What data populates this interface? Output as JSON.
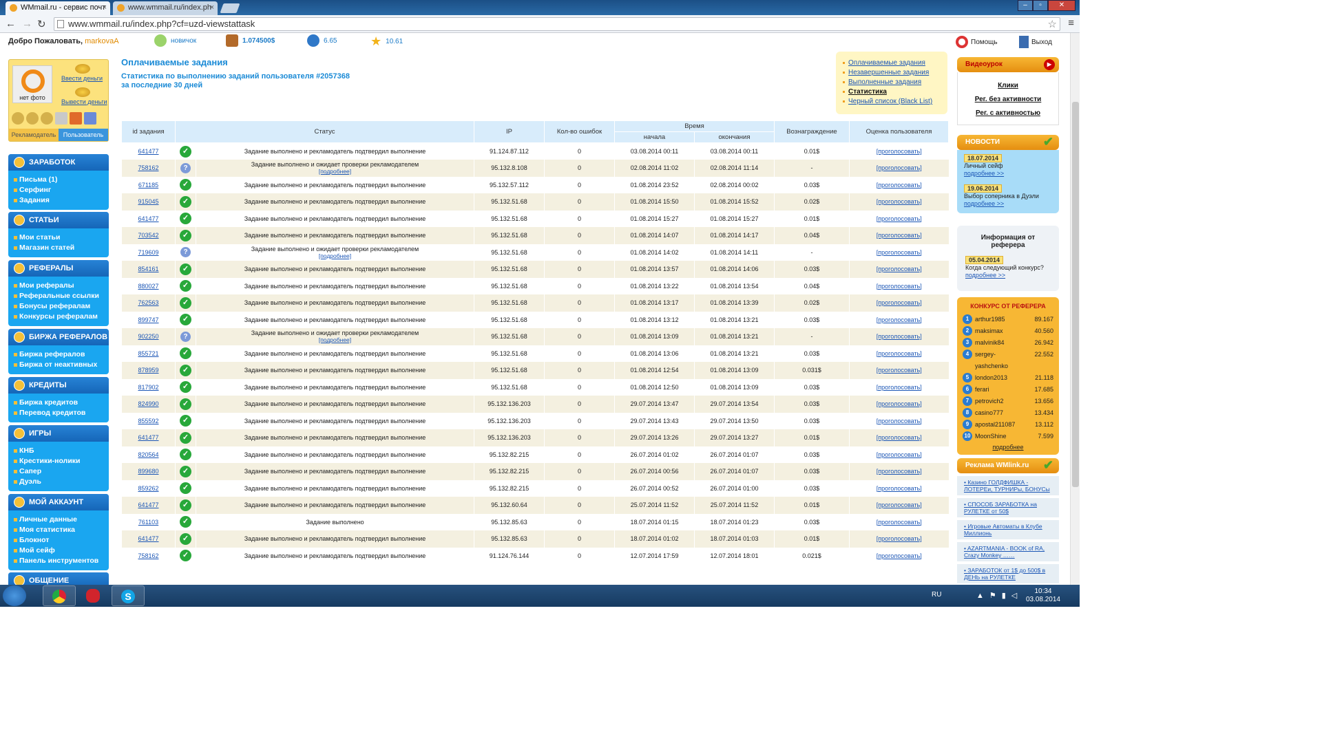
{
  "browser": {
    "tabs": [
      {
        "title": "WMmail.ru - сервис почт",
        "active": true
      },
      {
        "title": "www.wmmail.ru/index.ph",
        "active": false
      }
    ],
    "url": "www.wmmail.ru/index.php?cf=uzd-viewstattask"
  },
  "header": {
    "welcome": "Добро Пожаловать,",
    "username": "markovaA",
    "level": "новичок",
    "balance": "1.074500$",
    "credits": "6.65",
    "rating": "10.61",
    "help": "Помощь",
    "exit": "Выход"
  },
  "profile": {
    "no_photo": "нет фото",
    "deposit": "Ввести деньги",
    "withdraw": "Вывести деньги",
    "role_advertiser": "Рекламодатель",
    "role_user": "Пользователь"
  },
  "sidebar": [
    {
      "title": "ЗАРАБОТОК",
      "items": [
        "Письма (1)",
        "Серфинг",
        "Задания"
      ]
    },
    {
      "title": "СТАТЬИ",
      "items": [
        "Мои статьи",
        "Магазин статей"
      ]
    },
    {
      "title": "РЕФЕРАЛЫ",
      "items": [
        "Мои рефералы",
        "Реферальные ссылки",
        "Бонусы рефералам",
        "Конкурсы рефералам"
      ]
    },
    {
      "title": "БИРЖА РЕФЕРАЛОВ",
      "items": [
        "Биржа рефералов",
        "Биржа от неактивных"
      ]
    },
    {
      "title": "КРЕДИТЫ",
      "items": [
        "Биржа кредитов",
        "Перевод кредитов"
      ]
    },
    {
      "title": "ИГРЫ",
      "items": [
        "КНБ",
        "Крестики-нолики",
        "Сапер",
        "Дуэль"
      ]
    },
    {
      "title": "МОЙ АККАУНТ",
      "items": [
        "Личные данные",
        "Моя статистика",
        "Блокнот",
        "Мой сейф",
        "Панель инструментов"
      ]
    },
    {
      "title": "ОБЩЕНИЕ",
      "items": []
    }
  ],
  "main": {
    "title": "Оплачиваемые задания",
    "subtitle_1": "Статистика по выполнению заданий пользователя #2057368",
    "subtitle_2": "за последние 30 дней"
  },
  "task_menu": [
    "Оплачиваемые задания",
    "Незавершенные задания",
    "Выполненные задания",
    "Статистика",
    "Черный список (Black List)"
  ],
  "table": {
    "headers": {
      "id": "id задания",
      "status": "Статус",
      "ip": "IP",
      "errors": "Кол-во ошибок",
      "time": "Время",
      "start": "начала",
      "end": "окончания",
      "reward": "Вознаграждение",
      "rating": "Оценка пользователя"
    },
    "vote_label": "[проголосовать]",
    "more_label": "[подробнее]",
    "rows": [
      {
        "id": "641477",
        "state": "ok",
        "status": "Задание выполнено и рекламодатель подтвердил выполнение",
        "ip": "91.124.87.112",
        "errors": "0",
        "start": "03.08.2014 00:11",
        "end": "03.08.2014 00:11",
        "reward": "0.01$"
      },
      {
        "id": "758162",
        "state": "pending",
        "status": "Задание выполнено и ожидает проверки рекламодателем",
        "ip": "95.132.8.108",
        "errors": "0",
        "start": "02.08.2014 11:02",
        "end": "02.08.2014 11:14",
        "reward": "-"
      },
      {
        "id": "671185",
        "state": "ok",
        "status": "Задание выполнено и рекламодатель подтвердил выполнение",
        "ip": "95.132.57.112",
        "errors": "0",
        "start": "01.08.2014 23:52",
        "end": "02.08.2014 00:02",
        "reward": "0.03$"
      },
      {
        "id": "915045",
        "state": "ok",
        "status": "Задание выполнено и рекламодатель подтвердил выполнение",
        "ip": "95.132.51.68",
        "errors": "0",
        "start": "01.08.2014 15:50",
        "end": "01.08.2014 15:52",
        "reward": "0.02$"
      },
      {
        "id": "641477",
        "state": "ok",
        "status": "Задание выполнено и рекламодатель подтвердил выполнение",
        "ip": "95.132.51.68",
        "errors": "0",
        "start": "01.08.2014 15:27",
        "end": "01.08.2014 15:27",
        "reward": "0.01$"
      },
      {
        "id": "703542",
        "state": "ok",
        "status": "Задание выполнено и рекламодатель подтвердил выполнение",
        "ip": "95.132.51.68",
        "errors": "0",
        "start": "01.08.2014 14:07",
        "end": "01.08.2014 14:17",
        "reward": "0.04$"
      },
      {
        "id": "719609",
        "state": "pending",
        "status": "Задание выполнено и ожидает проверки рекламодателем",
        "ip": "95.132.51.68",
        "errors": "0",
        "start": "01.08.2014 14:02",
        "end": "01.08.2014 14:11",
        "reward": "-"
      },
      {
        "id": "854161",
        "state": "ok",
        "status": "Задание выполнено и рекламодатель подтвердил выполнение",
        "ip": "95.132.51.68",
        "errors": "0",
        "start": "01.08.2014 13:57",
        "end": "01.08.2014 14:06",
        "reward": "0.03$"
      },
      {
        "id": "880027",
        "state": "ok",
        "status": "Задание выполнено и рекламодатель подтвердил выполнение",
        "ip": "95.132.51.68",
        "errors": "0",
        "start": "01.08.2014 13:22",
        "end": "01.08.2014 13:54",
        "reward": "0.04$"
      },
      {
        "id": "762563",
        "state": "ok",
        "status": "Задание выполнено и рекламодатель подтвердил выполнение",
        "ip": "95.132.51.68",
        "errors": "0",
        "start": "01.08.2014 13:17",
        "end": "01.08.2014 13:39",
        "reward": "0.02$"
      },
      {
        "id": "899747",
        "state": "ok",
        "status": "Задание выполнено и рекламодатель подтвердил выполнение",
        "ip": "95.132.51.68",
        "errors": "0",
        "start": "01.08.2014 13:12",
        "end": "01.08.2014 13:21",
        "reward": "0.03$"
      },
      {
        "id": "902250",
        "state": "pending",
        "status": "Задание выполнено и ожидает проверки рекламодателем",
        "ip": "95.132.51.68",
        "errors": "0",
        "start": "01.08.2014 13:09",
        "end": "01.08.2014 13:21",
        "reward": "-"
      },
      {
        "id": "855721",
        "state": "ok",
        "status": "Задание выполнено и рекламодатель подтвердил выполнение",
        "ip": "95.132.51.68",
        "errors": "0",
        "start": "01.08.2014 13:06",
        "end": "01.08.2014 13:21",
        "reward": "0.03$"
      },
      {
        "id": "878959",
        "state": "ok",
        "status": "Задание выполнено и рекламодатель подтвердил выполнение",
        "ip": "95.132.51.68",
        "errors": "0",
        "start": "01.08.2014 12:54",
        "end": "01.08.2014 13:09",
        "reward": "0.031$"
      },
      {
        "id": "817902",
        "state": "ok",
        "status": "Задание выполнено и рекламодатель подтвердил выполнение",
        "ip": "95.132.51.68",
        "errors": "0",
        "start": "01.08.2014 12:50",
        "end": "01.08.2014 13:09",
        "reward": "0.03$"
      },
      {
        "id": "824990",
        "state": "ok",
        "status": "Задание выполнено и рекламодатель подтвердил выполнение",
        "ip": "95.132.136.203",
        "errors": "0",
        "start": "29.07.2014 13:47",
        "end": "29.07.2014 13:54",
        "reward": "0.03$"
      },
      {
        "id": "855592",
        "state": "ok",
        "status": "Задание выполнено и рекламодатель подтвердил выполнение",
        "ip": "95.132.136.203",
        "errors": "0",
        "start": "29.07.2014 13:43",
        "end": "29.07.2014 13:50",
        "reward": "0.03$"
      },
      {
        "id": "641477",
        "state": "ok",
        "status": "Задание выполнено и рекламодатель подтвердил выполнение",
        "ip": "95.132.136.203",
        "errors": "0",
        "start": "29.07.2014 13:26",
        "end": "29.07.2014 13:27",
        "reward": "0.01$"
      },
      {
        "id": "820564",
        "state": "ok",
        "status": "Задание выполнено и рекламодатель подтвердил выполнение",
        "ip": "95.132.82.215",
        "errors": "0",
        "start": "26.07.2014 01:02",
        "end": "26.07.2014 01:07",
        "reward": "0.03$"
      },
      {
        "id": "899680",
        "state": "ok",
        "status": "Задание выполнено и рекламодатель подтвердил выполнение",
        "ip": "95.132.82.215",
        "errors": "0",
        "start": "26.07.2014 00:56",
        "end": "26.07.2014 01:07",
        "reward": "0.03$"
      },
      {
        "id": "859262",
        "state": "ok",
        "status": "Задание выполнено и рекламодатель подтвердил выполнение",
        "ip": "95.132.82.215",
        "errors": "0",
        "start": "26.07.2014 00:52",
        "end": "26.07.2014 01:00",
        "reward": "0.03$"
      },
      {
        "id": "641477",
        "state": "ok",
        "status": "Задание выполнено и рекламодатель подтвердил выполнение",
        "ip": "95.132.60.64",
        "errors": "0",
        "start": "25.07.2014 11:52",
        "end": "25.07.2014 11:52",
        "reward": "0.01$"
      },
      {
        "id": "761103",
        "state": "ok",
        "status": "Задание выполнено",
        "ip": "95.132.85.63",
        "errors": "0",
        "start": "18.07.2014 01:15",
        "end": "18.07.2014 01:23",
        "reward": "0.03$"
      },
      {
        "id": "641477",
        "state": "ok",
        "status": "Задание выполнено и рекламодатель подтвердил выполнение",
        "ip": "95.132.85.63",
        "errors": "0",
        "start": "18.07.2014 01:02",
        "end": "18.07.2014 01:03",
        "reward": "0.01$"
      },
      {
        "id": "758162",
        "state": "ok",
        "status": "Задание выполнено и рекламодатель подтвердил выполнение",
        "ip": "91.124.76.144",
        "errors": "0",
        "start": "12.07.2014 17:59",
        "end": "12.07.2014 18:01",
        "reward": "0.021$"
      }
    ]
  },
  "right": {
    "video": {
      "title": "Видеоурок",
      "links": [
        "Клики",
        "Рег. без активности",
        "Рег. с активностью"
      ]
    },
    "news": {
      "title": "НОВОСТИ",
      "items": [
        {
          "date": "18.07.2014",
          "text": "Личный сейф"
        },
        {
          "date": "19.06.2014",
          "text": "Выбор соперника в Дуэли"
        }
      ],
      "more": "подробнее >>"
    },
    "referrer": {
      "title": "Информация от реферера",
      "date": "05.04.2014",
      "text": "Когда следующий конкурс?",
      "more": "подробнее >>"
    },
    "contest": {
      "title": "КОНКУРС ОТ РЕФЕРЕРА",
      "rows": [
        {
          "n": "1",
          "name": "arthur1985",
          "score": "89.167"
        },
        {
          "n": "2",
          "name": "maksimax",
          "score": "40.560"
        },
        {
          "n": "3",
          "name": "malvinik84",
          "score": "26.942"
        },
        {
          "n": "4",
          "name": "sergey-yashchenko",
          "score": "22.552"
        },
        {
          "n": "5",
          "name": "london2013",
          "score": "21.118"
        },
        {
          "n": "6",
          "name": "ferari",
          "score": "17.685"
        },
        {
          "n": "7",
          "name": "petrovich2",
          "score": "13.656"
        },
        {
          "n": "8",
          "name": "casino777",
          "score": "13.434"
        },
        {
          "n": "9",
          "name": "apostal211087",
          "score": "13.112"
        },
        {
          "n": "10",
          "name": "MoonShine",
          "score": "7.599"
        }
      ],
      "more": "подробнее"
    },
    "ads": {
      "title": "Реклама WMlink.ru",
      "items": [
        "Казино ГОЛДФИШКА - ЛОТЕРЕи, ТУРНИРы, БОНУСы",
        "СПОСОБ ЗАРАБОТКА на РУЛЕТКЕ от 50$",
        "Игровые Автоматы в Клубе Миллионь",
        "AZARTMANIA - BOOK of RA, Crazy Monkey ……",
        "ЗАРАБОТОК от 1$ до 500$ в ДЕНЬ на РУЛЕТКЕ"
      ]
    }
  },
  "taskbar": {
    "lang": "RU",
    "time": "10:34",
    "date": "03.08.2014"
  },
  "colors": {
    "accent": "#1a8ad6",
    "nav_bg": "#1aa6f0",
    "ok": "#28a83a",
    "row_alt": "#f4f0e0",
    "header_bg": "#d8ecfb"
  }
}
